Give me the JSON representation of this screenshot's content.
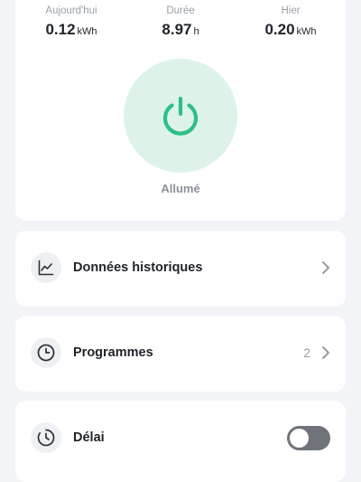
{
  "stats": {
    "today": {
      "label": "Aujourd'hui",
      "value": "0.12",
      "unit": "kWh"
    },
    "duration": {
      "label": "Durée",
      "value": "8.97",
      "unit": "h"
    },
    "yesterday": {
      "label": "Hier",
      "value": "0.20",
      "unit": "kWh"
    }
  },
  "power": {
    "status": "Allumé",
    "icon": "power-icon",
    "accent": "#2fbf86",
    "background": "#ddf3ea"
  },
  "rows": {
    "history": {
      "label": "Données historiques",
      "icon": "chart-line-icon"
    },
    "schedule": {
      "label": "Programmes",
      "count": "2",
      "icon": "clock-icon"
    },
    "delay": {
      "label": "Délai",
      "icon": "timer-icon",
      "toggle_on": false
    }
  }
}
